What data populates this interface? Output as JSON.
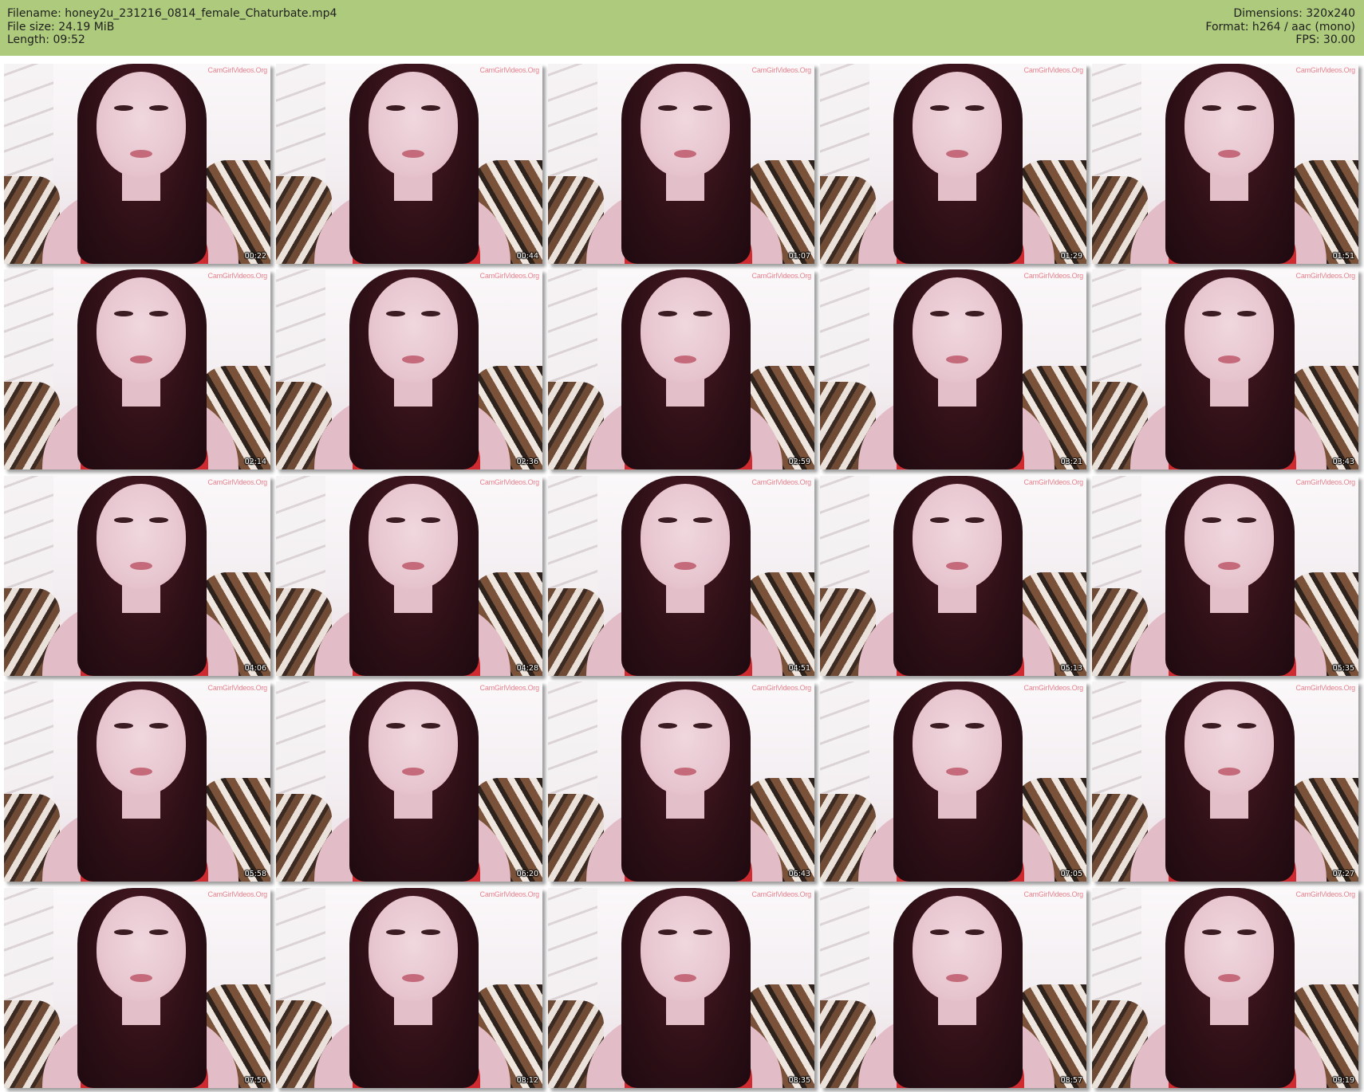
{
  "header": {
    "filename": "Filename: honey2u_231216_0814_female_Chaturbate.mp4",
    "file_size": "File size: 24.19 MiB",
    "length": "Length: 09:52",
    "dimensions": "Dimensions: 320x240",
    "format": "Format: h264 / aac (mono)",
    "fps": "FPS: 30.00"
  },
  "watermark_text": "CamGirlVideos.Org",
  "thumbnails": [
    {
      "timestamp": "00:22"
    },
    {
      "timestamp": "00:44"
    },
    {
      "timestamp": "01:07"
    },
    {
      "timestamp": "01:29"
    },
    {
      "timestamp": "01:51"
    },
    {
      "timestamp": "02:14"
    },
    {
      "timestamp": "02:36"
    },
    {
      "timestamp": "02:59"
    },
    {
      "timestamp": "03:21"
    },
    {
      "timestamp": "03:43"
    },
    {
      "timestamp": "04:06"
    },
    {
      "timestamp": "04:28"
    },
    {
      "timestamp": "04:51"
    },
    {
      "timestamp": "05:13"
    },
    {
      "timestamp": "05:35"
    },
    {
      "timestamp": "05:58"
    },
    {
      "timestamp": "06:20"
    },
    {
      "timestamp": "06:43"
    },
    {
      "timestamp": "07:05"
    },
    {
      "timestamp": "07:27"
    },
    {
      "timestamp": "07:50"
    },
    {
      "timestamp": "08:12"
    },
    {
      "timestamp": "08:35"
    },
    {
      "timestamp": "08:57"
    },
    {
      "timestamp": "09:19"
    }
  ]
}
